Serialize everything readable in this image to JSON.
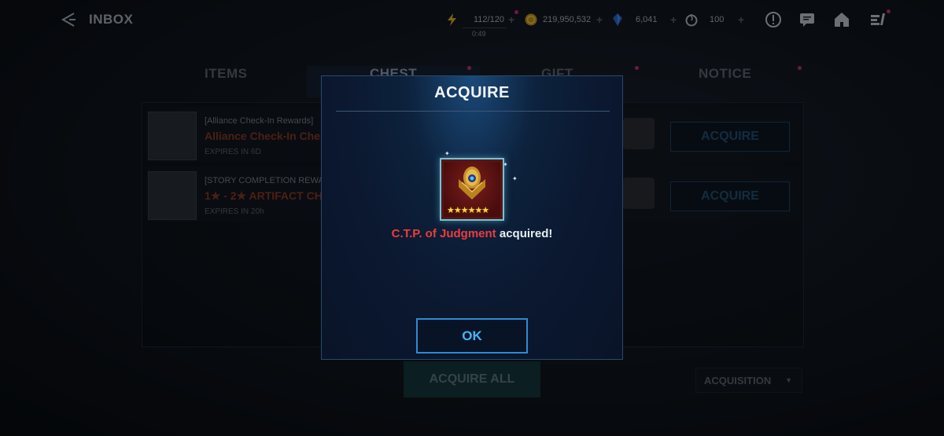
{
  "topbar": {
    "title": "INBOX",
    "energy": "112/120",
    "energy_timer": "0:49",
    "gold": "219,950,532",
    "crystals": "6,041",
    "stamina": "100"
  },
  "tabs": [
    {
      "label": "ITEMS"
    },
    {
      "label": "CHEST"
    },
    {
      "label": "GIFT"
    },
    {
      "label": "NOTICE"
    }
  ],
  "rows": [
    {
      "category": "[Alliance Check-In Rewards]",
      "name": "Alliance Check-In Chest",
      "expires": "EXPIRES IN 6D",
      "button": "ACQUIRE"
    },
    {
      "category": "[STORY COMPLETION REWARD]",
      "name": "1★ - 2★ ARTIFACT CHEST",
      "expires": "EXPIRES IN 20h",
      "button": "ACQUIRE"
    }
  ],
  "footer": {
    "acquire_all": "ACQUIRE ALL",
    "sort": "ACQUISITION"
  },
  "modal": {
    "title": "ACQUIRE",
    "item_name": "C.T.P. of Judgment",
    "message_suffix": " acquired!",
    "stars": "★★★★★★",
    "ok": "OK"
  },
  "colors": {
    "modal_accent": "#2f8ad0",
    "item_name": "#ef3b3b",
    "notification_dot": "#c2307c"
  }
}
